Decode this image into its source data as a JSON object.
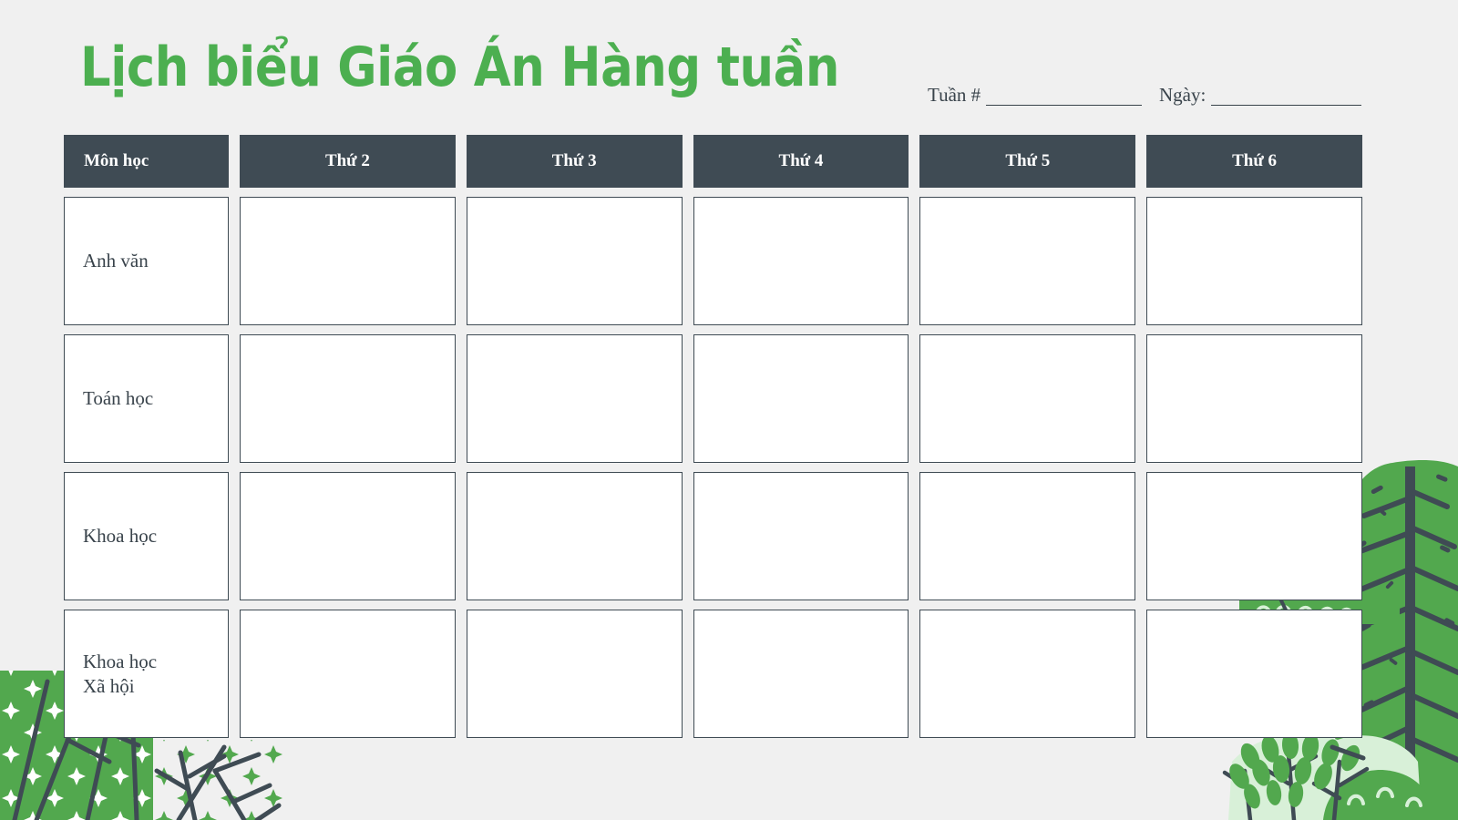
{
  "page": {
    "title": "Lịch biểu Giáo Án Hàng tuần",
    "background_color": "#f0f0f0",
    "accent_green": "#4caf50",
    "dark_slate": "#3f4b54",
    "leaf_light_green": "#cfeccf"
  },
  "fields": {
    "week": {
      "label": "Tuần #",
      "value": ""
    },
    "date": {
      "label": "Ngày:",
      "value": ""
    }
  },
  "table": {
    "headers": {
      "subject": "Môn học",
      "days": [
        "Thứ 2",
        "Thứ 3",
        "Thứ 4",
        "Thứ 5",
        "Thứ 6"
      ]
    },
    "rows": [
      {
        "subject": "Anh văn",
        "cells": [
          "",
          "",
          "",
          "",
          ""
        ]
      },
      {
        "subject": "Toán học",
        "cells": [
          "",
          "",
          "",
          "",
          ""
        ]
      },
      {
        "subject": "Khoa học",
        "cells": [
          "",
          "",
          "",
          "",
          ""
        ]
      },
      {
        "subject": "Khoa học\nXã hội",
        "cells": [
          "",
          "",
          "",
          "",
          ""
        ]
      }
    ]
  },
  "decorations": {
    "bottom_left": "sparkle-bush-illustration",
    "bottom_center": "branch-sparkle-illustration",
    "right": "conifer-tree-illustration",
    "bottom_right": "leafy-shrub-illustration"
  }
}
